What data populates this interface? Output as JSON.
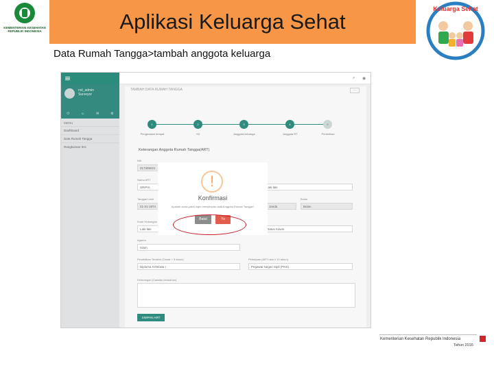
{
  "header": {
    "title": "Aplikasi Keluarga Sehat",
    "subtitle": "Data Rumah Tangga>tambah anggota keluarga",
    "left_logo_caption": "KEMENTERIAN KESEHATAN REPUBLIK INDONESIA",
    "right_logo_text": "Keluarga Sehat"
  },
  "app": {
    "sidebar": {
      "user_name": "nol_admin",
      "user_role": "Surveyor",
      "heading": "MENU",
      "items": [
        "Dashboard",
        "Data Rumah Tangga",
        "Rangkuman IKS"
      ]
    },
    "panel_title": "TAMBAH DATA RUMAH TANGGA",
    "steps": [
      {
        "num": "1",
        "label": "Pengenalan tempat"
      },
      {
        "num": "2",
        "label": "KK"
      },
      {
        "num": "3",
        "label": "Anggota keluarga"
      },
      {
        "num": "4",
        "label": "Anggota RT"
      },
      {
        "num": "5",
        "label": "Pemeriksa"
      }
    ],
    "section_title": "Keterangan Anggota Rumah Tangga(ART)",
    "fields": {
      "nik_label": "NIK",
      "nik_value": "317305021",
      "nama_label": "Nama ART",
      "nama_value": "SRIPIA",
      "tgl_label": "Tanggal Lahir",
      "tgl_value": "01-01-1974",
      "status_label": "Status Kawin",
      "status_value": "Janda",
      "bulan_label": "Bulan",
      "bulan_value": "Bulan",
      "kode_label": "Kode Hubungan",
      "kode_value": "Laki-laki",
      "agama_label": "Agama",
      "agama_value": "Islam",
      "pendidikan_label": "Pendidikan Terakhir (Tamat + 5 tahun)",
      "pendidikan_value": "Diploma IV/Strata I",
      "pekerjaan_label": "Pekerjaan (ART usia ≥ 10 tahun)",
      "pekerjaan_value": "Pegawai Negeri Sipil (PNS)",
      "keterangan_label": "Keterangan (Catatan tambahan)"
    },
    "save_label": "SIMPAN ART"
  },
  "dialog": {
    "icon": "!",
    "title": "Konfirmasi",
    "text": "Apakah anda yakin ingin menyimpan data Anggota Rumah Tangga?",
    "cancel_label": "Batal",
    "confirm_label": "Ya"
  },
  "footer": {
    "ministry": "Kementerian Kesehatan Republik Indonesia",
    "year": "Tahun 2016"
  },
  "colors": {
    "header_bar": "#f79646",
    "app_teal": "#2e8b7d",
    "confirm": "#e35d4e",
    "cancel": "#8c8c8c",
    "highlight_ring": "#c81e2a"
  }
}
